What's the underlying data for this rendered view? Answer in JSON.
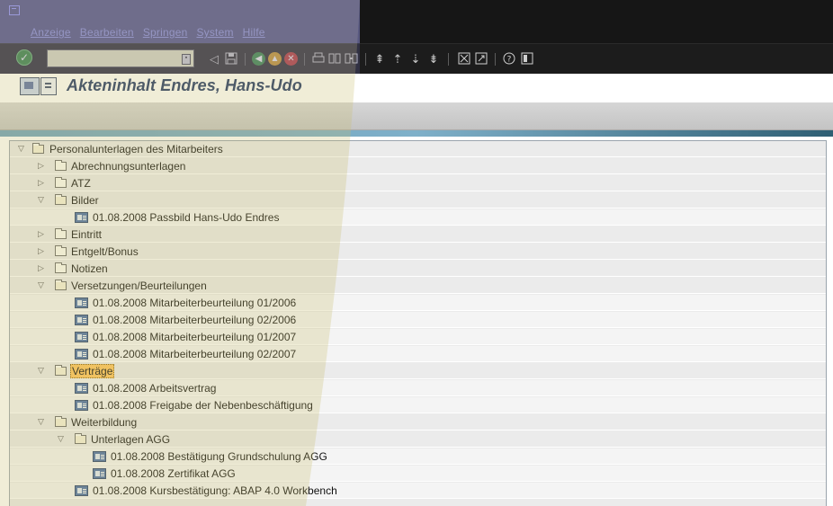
{
  "menu": [
    "Anzeige",
    "Bearbeiten",
    "Springen",
    "System",
    "Hilfe"
  ],
  "toolbar": {
    "command_value": "",
    "icons": [
      "ok-icon",
      "command-history-icon",
      "back-arrow-icon",
      "save-icon",
      "back-icon",
      "exit-icon",
      "cancel-icon",
      "print-icon",
      "find-icon",
      "find-next-icon",
      "first-page-icon",
      "previous-page-icon",
      "next-page-icon",
      "last-page-icon",
      "create-session-icon",
      "shortcut-icon",
      "help-icon",
      "layout-menu-icon"
    ]
  },
  "header": {
    "title": "Akteninhalt Endres, Hans-Udo"
  },
  "tree": {
    "root": "Personalunterlagen des Mitarbeiters",
    "abrechnung": "Abrechnungsunterlagen",
    "atz": "ATZ",
    "bilder": "Bilder",
    "passbild": "01.08.2008 Passbild Hans-Udo Endres",
    "eintritt": "Eintritt",
    "entgelt": "Entgelt/Bonus",
    "notizen": "Notizen",
    "versetzungen": "Versetzungen/Beurteilungen",
    "beurteilung1": "01.08.2008 Mitarbeiterbeurteilung 01/2006",
    "beurteilung2": "01.08.2008 Mitarbeiterbeurteilung 02/2006",
    "beurteilung3": "01.08.2008 Mitarbeiterbeurteilung 01/2007",
    "beurteilung4": "01.08.2008 Mitarbeiterbeurteilung 02/2007",
    "vertraege": "Verträge",
    "arbeitsvertrag": "01.08.2008 Arbeitsvertrag",
    "nebenbeschaeftigung": "01.08.2008 Freigabe der Nebenbeschäftigung",
    "weiterbildung": "Weiterbildung",
    "unterlagen_agg": "Unterlagen AGG",
    "grundschulung": "01.08.2008 Bestätigung Grundschulung AGG",
    "zertifikat": "01.08.2008 Zertifikat AGG",
    "kursbestaetigung": "01.08.2008 Kursbestätigung: ABAP 4.0 Workbench"
  },
  "colors": {
    "selected": "#ffc45c",
    "title": "#1f3566",
    "overlay": "#c8c070"
  }
}
